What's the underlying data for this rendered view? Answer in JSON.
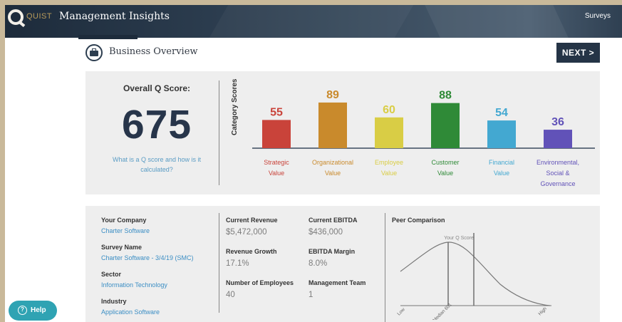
{
  "header": {
    "logo_text": "QUIST",
    "app_title": "Management Insights",
    "nav_link": "Surveys"
  },
  "page": {
    "title": "Business Overview",
    "next_button": "NEXT >"
  },
  "score": {
    "title": "Overall Q Score:",
    "value": "675",
    "help_line1": "What is a Q score and how is it",
    "help_line2": "calculated?"
  },
  "chart_data": {
    "type": "bar",
    "ylabel": "Category Scores",
    "categories": [
      {
        "lines": [
          "Strategic",
          "Value"
        ],
        "value": 55,
        "color": "#c9433a"
      },
      {
        "lines": [
          "Organizational",
          "Value"
        ],
        "value": 89,
        "color": "#c98a2c"
      },
      {
        "lines": [
          "Employee",
          "Value"
        ],
        "value": 60,
        "color": "#d9cd45"
      },
      {
        "lines": [
          "Customer",
          "Value"
        ],
        "value": 88,
        "color": "#2f8a37"
      },
      {
        "lines": [
          "Financial",
          "Value"
        ],
        "value": 54,
        "color": "#43a8d1"
      },
      {
        "lines": [
          "Environmental,",
          "Social &",
          "Governance"
        ],
        "value": 36,
        "color": "#6152b8"
      }
    ],
    "ylim": [
      0,
      100
    ]
  },
  "company": {
    "your_company_label": "Your Company",
    "your_company_value": "Charter Software",
    "survey_name_label": "Survey Name",
    "survey_name_value": "Charter Software - 3/4/19 (SMC)",
    "sector_label": "Sector",
    "sector_value": "Information Technology",
    "industry_label": "Industry",
    "industry_value": "Application Software"
  },
  "financials": {
    "current_revenue_label": "Current Revenue",
    "current_revenue_value": "$5,472,000",
    "current_ebitda_label": "Current EBITDA",
    "current_ebitda_value": "$436,000",
    "revenue_growth_label": "Revenue Growth",
    "revenue_growth_value": "17.1%",
    "ebitda_margin_label": "EBITDA Margin",
    "ebitda_margin_value": "8.0%",
    "employees_label": "Number of Employees",
    "employees_value": "40",
    "management_team_label": "Management Team",
    "management_team_value": "1"
  },
  "peer": {
    "title": "Peer Comparison",
    "your_score_label": "Your Q Score",
    "axis_low": "Low",
    "axis_median": "Median 601",
    "axis_high": "High"
  },
  "help": {
    "label": "Help",
    "icon": "?"
  },
  "colors": {
    "navy": "#253446",
    "link_blue": "#3b8ec4",
    "panel_gray": "#eeeeee"
  }
}
